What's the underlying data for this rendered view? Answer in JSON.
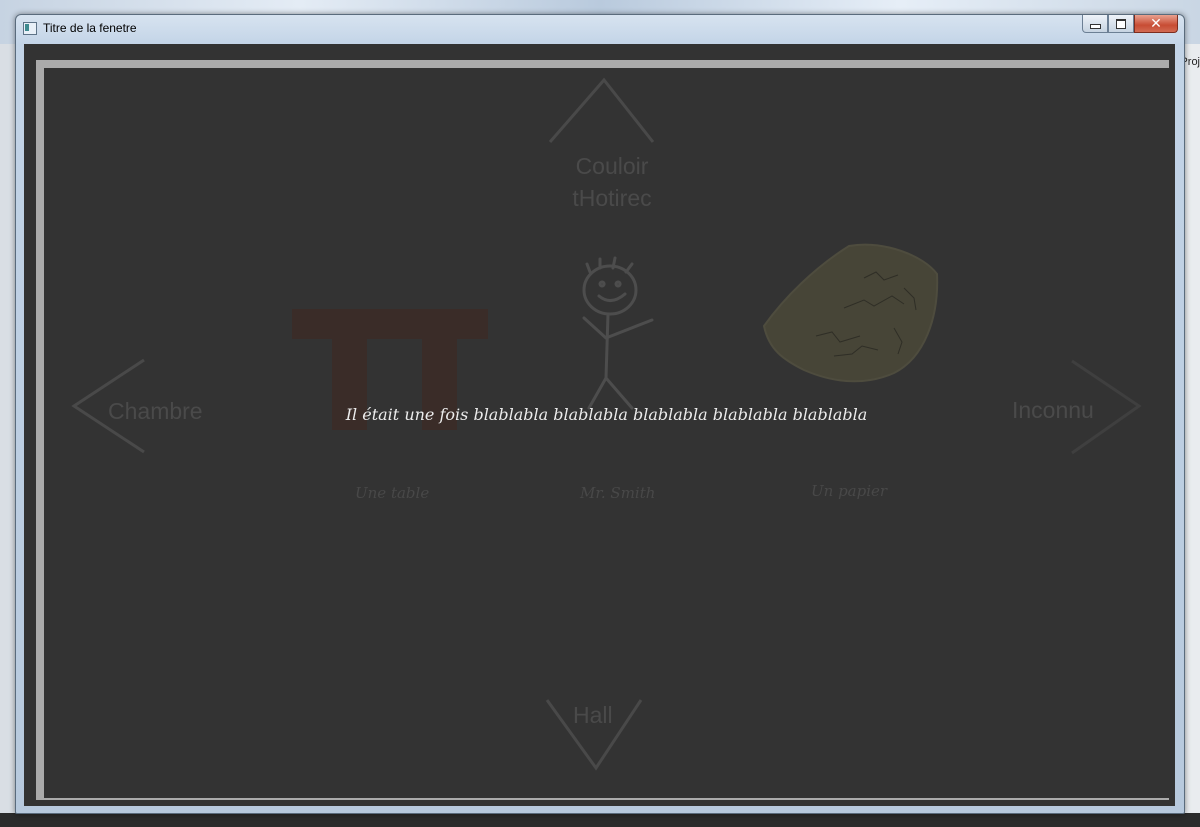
{
  "window": {
    "title": "Titre de la fenetre",
    "controls": {
      "minimize": "minimize",
      "maximize": "maximize",
      "close": "✕"
    }
  },
  "background": {
    "right_label": "Proj"
  },
  "scene": {
    "story_text": "Il était une fois blablabla blablabla blablabla blablabla blablabla",
    "exits": {
      "up": "Couloir\ntHotirec",
      "left": "Chambre",
      "right": "Inconnu",
      "down": "Hall"
    },
    "objects": [
      {
        "label": "Une table",
        "icon": "table-icon",
        "color": "#3a2c28"
      },
      {
        "label": "Mr. Smith",
        "icon": "stick-figure-icon",
        "color": "#4a4a4a"
      },
      {
        "label": "Un papier",
        "icon": "paper-icon",
        "color": "#4a4838"
      }
    ]
  },
  "colors": {
    "stage_bg": "#333333",
    "frame": "#ababab",
    "nav_arrows": "#4a4a4a",
    "story_text": "#ececec"
  }
}
